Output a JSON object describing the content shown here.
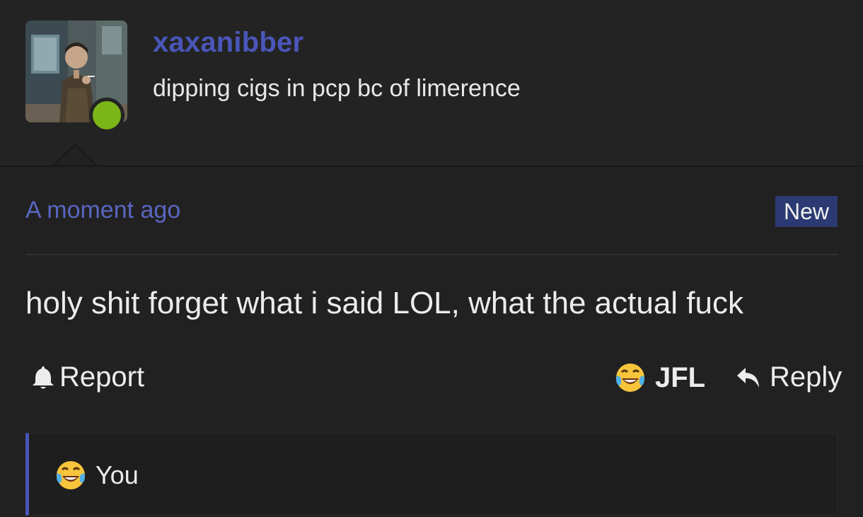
{
  "user": {
    "name": "xaxanibber",
    "title": "dipping cigs in pcp bc of limerence",
    "online_color": "#7cb518",
    "name_color": "#4a56b8"
  },
  "post": {
    "timestamp": "A moment ago",
    "badge": "New",
    "content": "holy shit forget what i said LOL, what the actual fuck"
  },
  "actions": {
    "report_label": "Report",
    "reaction_label": "JFL",
    "reply_label": "Reply"
  },
  "reactions": {
    "label": "You",
    "emoji": "face-with-tears-of-joy"
  },
  "colors": {
    "accent": "#4a56b8",
    "badge_bg": "#2b3a72",
    "background": "#232323"
  }
}
